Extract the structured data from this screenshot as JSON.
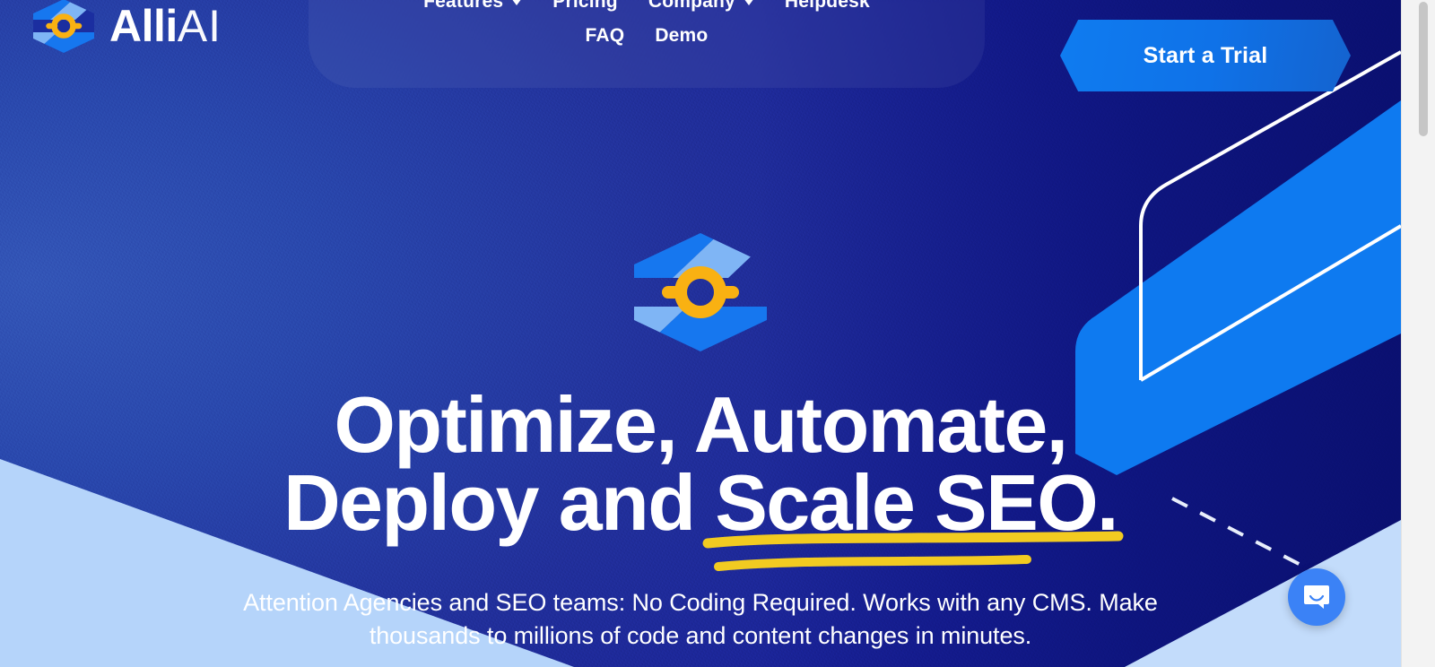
{
  "brand": {
    "name_bold": "Alli",
    "name_light": "AI",
    "logo_icon": "alliai-hexagon-logo"
  },
  "nav": {
    "row1": [
      {
        "label": "Features",
        "has_dropdown": true
      },
      {
        "label": "Pricing",
        "has_dropdown": false
      },
      {
        "label": "Company",
        "has_dropdown": true
      },
      {
        "label": "Helpdesk",
        "has_dropdown": false
      }
    ],
    "row2": [
      {
        "label": "FAQ",
        "has_dropdown": false
      },
      {
        "label": "Demo",
        "has_dropdown": false
      }
    ]
  },
  "cta": {
    "label": "Start a Trial"
  },
  "hero": {
    "logo_icon": "alliai-hexagon-logo-large",
    "headline_line1": "Optimize, Automate,",
    "headline_line2_plain": "Deploy and ",
    "headline_line2_underlined": "Scale SEO.",
    "subtitle": "Attention Agencies and SEO teams: No Coding Required. Works with any CMS. Make thousands to millions of code and content changes in minutes."
  },
  "chat": {
    "icon": "chat-bubble-icon",
    "aria_label": "Open Intercom Messenger"
  },
  "colors": {
    "bg_blue_left": "#2F50B2",
    "bg_navy_right": "#121A8C",
    "accent_blue": "#0F7CF0",
    "logo_light_blue": "#7FB5F5",
    "logo_orange": "#F9B112",
    "underline_yellow": "#F2CB21",
    "wedge_light_blue": "#B5D4FA",
    "chat_blue": "#3B82F6",
    "text_white": "#FFFFFF"
  }
}
